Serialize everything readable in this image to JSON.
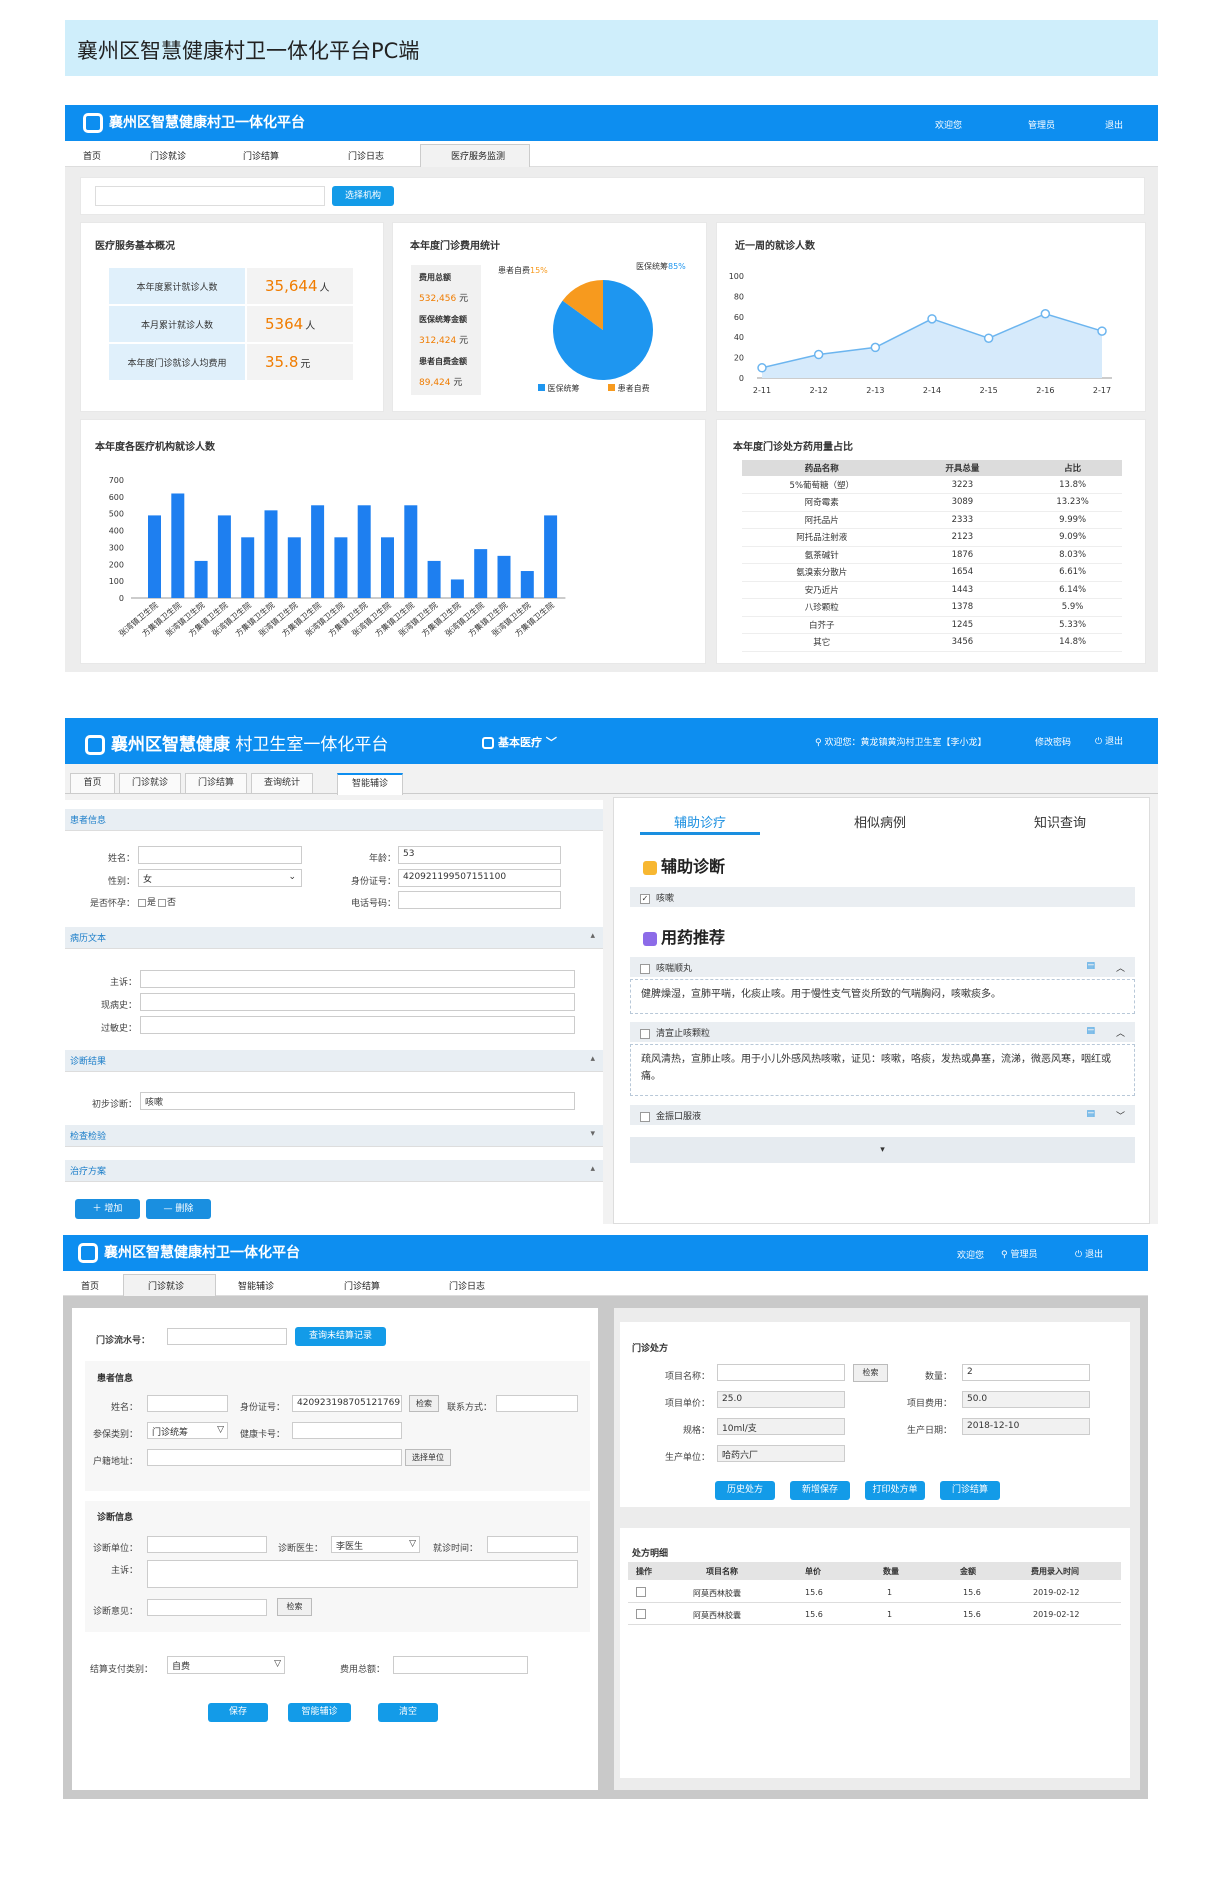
{
  "banner": {
    "title": "襄州区智慧健康村卫一体化平台PC端"
  },
  "screen1": {
    "header": {
      "title": "襄州区智慧健康村卫一体化平台",
      "welcome": "欢迎您",
      "user": "管理员",
      "logout": "退出"
    },
    "nav": [
      "首页",
      "门诊就诊",
      "门诊结算",
      "门诊日志",
      "医疗服务监测"
    ],
    "select_btn": "选择机构",
    "overview": {
      "title": "医疗服务基本概况",
      "rows": [
        {
          "label": "本年度累计就诊人数",
          "value": "35,644",
          "unit": "人"
        },
        {
          "label": "本月累计就诊人数",
          "value": "5364",
          "unit": "人"
        },
        {
          "label": "本年度门诊就诊人均费用",
          "value": "35.8",
          "unit": "元"
        }
      ]
    },
    "cost": {
      "title": "本年度门诊费用统计",
      "items": [
        {
          "label": "费用总额",
          "value": "532,456",
          "unit": "元"
        },
        {
          "label": "医保统筹金额",
          "value": "312,424",
          "unit": "元"
        },
        {
          "label": "患者自费金额",
          "value": "89,424",
          "unit": "元"
        }
      ],
      "pie_label_self": "患者自费",
      "pie_pct_self": "15%",
      "pie_label_ins": "医保统筹",
      "pie_pct_ins": "85%",
      "legend_ins": "医保统筹",
      "legend_self": "患者自费"
    },
    "week": {
      "title": "近一周的就诊人数"
    },
    "inst": {
      "title": "本年度各医疗机构就诊人数"
    },
    "drug": {
      "title": "本年度门诊处方药用量占比",
      "headers": [
        "药品名称",
        "开具总量",
        "占比"
      ],
      "rows": [
        [
          "5%葡萄糖（塑）",
          "3223",
          "13.8%"
        ],
        [
          "阿奇霉素",
          "3089",
          "13.23%"
        ],
        [
          "阿托品片",
          "2333",
          "9.99%"
        ],
        [
          "阿托品注射液",
          "2123",
          "9.09%"
        ],
        [
          "氨茶碱针",
          "1876",
          "8.03%"
        ],
        [
          "氨溴索分散片",
          "1654",
          "6.61%"
        ],
        [
          "安乃近片",
          "1443",
          "6.14%"
        ],
        [
          "八珍颗粒",
          "1378",
          "5.9%"
        ],
        [
          "白芥子",
          "1245",
          "5.33%"
        ],
        [
          "其它",
          "3456",
          "14.8%"
        ]
      ]
    }
  },
  "chart_data": [
    {
      "type": "pie",
      "title": "本年度门诊费用统计",
      "categories": [
        "医保统筹",
        "患者自费"
      ],
      "values": [
        85,
        15
      ],
      "colors": [
        "#1e96f0",
        "#f79a1e"
      ]
    },
    {
      "type": "area",
      "title": "近一周的就诊人数",
      "x": [
        "2-11",
        "2-12",
        "2-13",
        "2-14",
        "2-15",
        "2-16",
        "2-17"
      ],
      "values": [
        10,
        23,
        30,
        58,
        39,
        63,
        46
      ],
      "ylim": [
        0,
        100
      ],
      "yticks": [
        0,
        20,
        40,
        60,
        80,
        100
      ]
    },
    {
      "type": "bar",
      "title": "本年度各医疗机构就诊人数",
      "categories": [
        "张湾镇卫生院",
        "方集镇卫生院",
        "张湾镇卫生院",
        "方集镇卫生院",
        "张湾镇卫生院",
        "方集镇卫生院",
        "张湾镇卫生院",
        "方集镇卫生院",
        "张湾镇卫生院",
        "方集镇卫生院",
        "张湾镇卫生院",
        "方集镇卫生院",
        "张湾镇卫生院",
        "方集镇卫生院",
        "张湾镇卫生院",
        "方集镇卫生院",
        "张湾镇卫生院",
        "方集镇卫生院"
      ],
      "values": [
        490,
        620,
        220,
        490,
        360,
        520,
        360,
        550,
        360,
        550,
        360,
        550,
        220,
        110,
        290,
        250,
        160,
        490
      ],
      "ylim": [
        0,
        700
      ],
      "yticks": [
        0,
        100,
        200,
        300,
        400,
        500,
        600,
        700
      ]
    }
  ],
  "screen2": {
    "header": {
      "title_bold": "襄州区智慧健康",
      "title_rest": " 村卫生室一体化平台",
      "menu": "基本医疗",
      "welcome": "欢迎您：黄龙镇黄沟村卫生室【李小龙】",
      "change_pwd": "修改密码",
      "logout": "退出"
    },
    "tabs": [
      "首页",
      "门诊就诊",
      "门诊结算",
      "查询统计",
      "智能辅诊"
    ],
    "patient": {
      "section": "患者信息",
      "name_label": "姓名：",
      "age_label": "年龄：",
      "age": "53",
      "gender_label": "性别：",
      "gender": "女",
      "id_label": "身份证号：",
      "id": "420921199507151100",
      "pregnant_label": "是否怀孕：",
      "yes": "是",
      "no": "否",
      "phone_label": "电话号码："
    },
    "history": {
      "section": "病历文本",
      "chief": "主诉：",
      "present": "现病史：",
      "past": "过敏史："
    },
    "diag": {
      "section": "诊断结果",
      "initial_label": "初步诊断：",
      "initial": "咳嗽"
    },
    "exam": {
      "section": "检查检验"
    },
    "treat": {
      "section": "治疗方案",
      "add": "增加",
      "del": "删除"
    },
    "right_tabs": [
      "辅助诊疗",
      "相似病例",
      "知识查询"
    ],
    "assist_title": "辅助诊断",
    "assist_item": "咳嗽",
    "recommend_title": "用药推荐",
    "meds": [
      {
        "name": "咳喘顺丸",
        "desc": "健脾燥湿，宣肺平喘，化痰止咳。用于慢性支气管炎所致的气喘胸闷，咳嗽痰多。"
      },
      {
        "name": "清宣止咳颗粒",
        "desc": "疏风清热，宣肺止咳。用于小儿外感风热咳嗽，证见：咳嗽，咯痰，发热或鼻塞，流涕，微恶风寒，咽红或痛。"
      },
      {
        "name": "金振口服液",
        "desc": ""
      }
    ]
  },
  "screen3": {
    "header": {
      "title": "襄州区智慧健康村卫一体化平台",
      "welcome": "欢迎您",
      "user": "管理员",
      "logout": "退出"
    },
    "nav": [
      "首页",
      "门诊就诊",
      "智能辅诊",
      "门诊结算",
      "门诊日志"
    ],
    "serial_label": "门诊流水号：",
    "query_btn": "查询未结算记录",
    "patient": {
      "title": "患者信息",
      "name": "姓名：",
      "id_label": "身份证号：",
      "id": "420923198705121769",
      "search": "检索",
      "contact": "联系方式：",
      "ins_type": "参保类别：",
      "ins_value": "门诊统筹",
      "card": "健康卡号：",
      "addr": "户籍地址：",
      "select_unit": "选择单位"
    },
    "diag": {
      "title": "诊断信息",
      "unit": "诊断单位：",
      "doctor_label": "诊断医生：",
      "doctor": "李医生",
      "time": "就诊时间：",
      "chief": "主诉：",
      "opinion": "诊断意见：",
      "search": "检索"
    },
    "pay": {
      "type_label": "结算支付类别：",
      "type": "自费",
      "total_label": "费用总额："
    },
    "buttons": [
      "保存",
      "智能辅诊",
      "清空"
    ],
    "rx": {
      "title": "门诊处方",
      "item_name": "项目名称：",
      "search": "检索",
      "qty_label": "数量：",
      "qty": "2",
      "price_label": "项目单价：",
      "price": "25.0",
      "cost_label": "项目费用：",
      "cost": "50.0",
      "spec_label": "规格：",
      "spec": "10ml/支",
      "date_label": "生产日期：",
      "date": "2018-12-10",
      "maker_label": "生产单位：",
      "maker": "哈药六厂",
      "buttons": [
        "历史处方",
        "新增保存",
        "打印处方单",
        "门诊结算"
      ]
    },
    "detail": {
      "title": "处方明细",
      "headers": [
        "操作",
        "项目名称",
        "单价",
        "数量",
        "金额",
        "费用录入时间"
      ],
      "rows": [
        [
          "",
          "阿莫西林胶囊",
          "15.6",
          "1",
          "15.6",
          "2019-02-12"
        ],
        [
          "",
          "阿莫西林胶囊",
          "15.6",
          "1",
          "15.6",
          "2019-02-12"
        ]
      ]
    }
  }
}
